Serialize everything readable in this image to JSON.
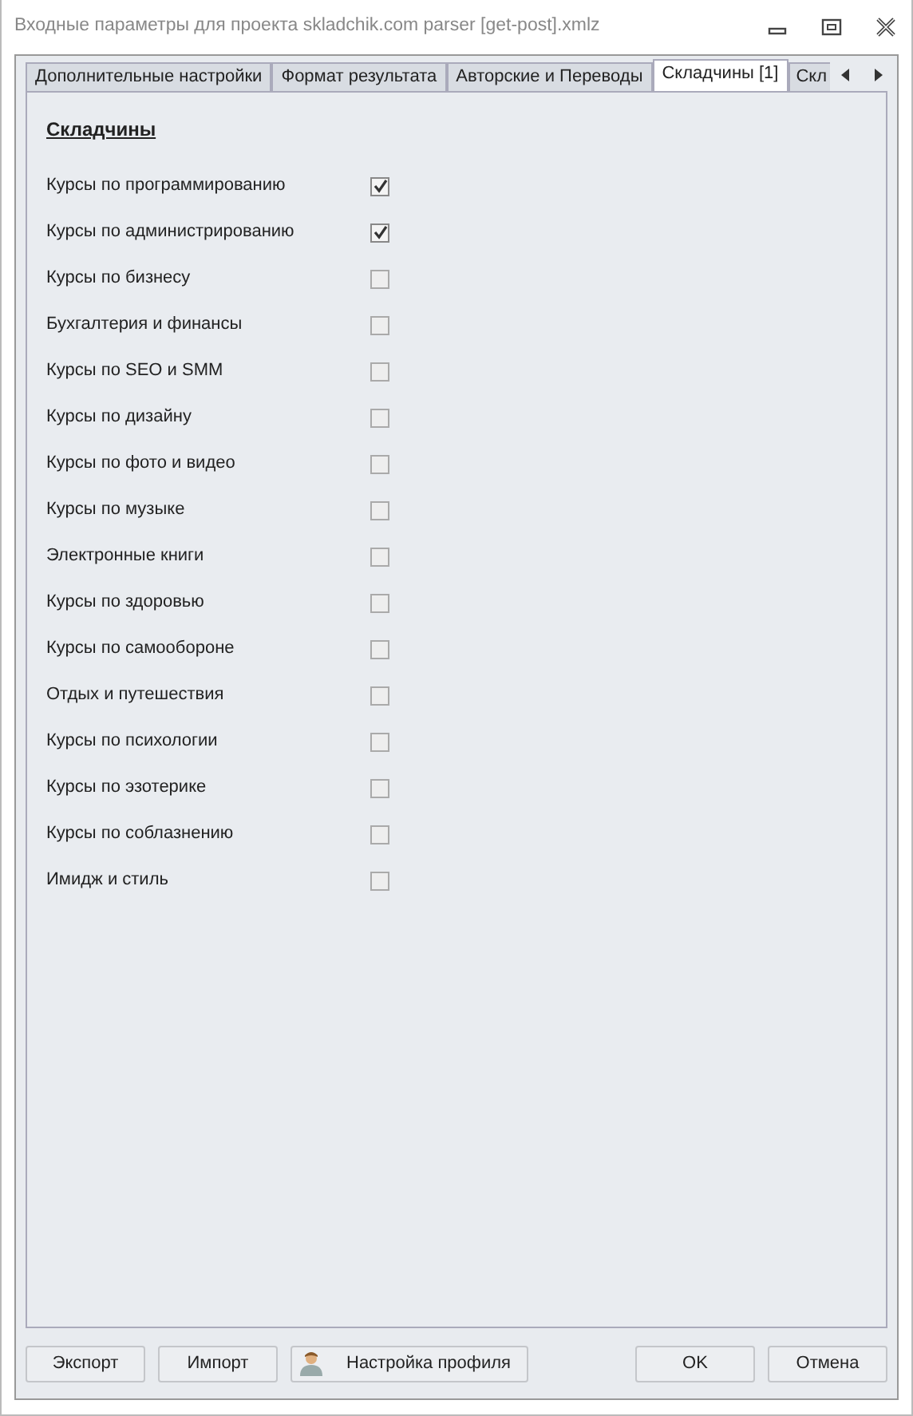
{
  "window": {
    "title": "Входные параметры для проекта skladchik.com parser [get-post].xmlz"
  },
  "tabs": [
    {
      "label": "Дополнительные настройки",
      "selected": false
    },
    {
      "label": "Формат результата",
      "selected": false
    },
    {
      "label": "Авторские и Переводы",
      "selected": false
    },
    {
      "label": "Складчины [1]",
      "selected": true
    },
    {
      "label": "Скл",
      "selected": false
    }
  ],
  "section": {
    "title": "Складчины"
  },
  "options": [
    {
      "label": "Курсы по программированию",
      "checked": true
    },
    {
      "label": "Курсы по администрированию",
      "checked": true
    },
    {
      "label": "Курсы по бизнесу",
      "checked": false
    },
    {
      "label": "Бухгалтерия и финансы",
      "checked": false
    },
    {
      "label": "Курсы по SEO и SMM",
      "checked": false
    },
    {
      "label": "Курсы по дизайну",
      "checked": false
    },
    {
      "label": "Курсы по фото и видео",
      "checked": false
    },
    {
      "label": "Курсы по музыке",
      "checked": false
    },
    {
      "label": "Электронные книги",
      "checked": false
    },
    {
      "label": "Курсы по здоровью",
      "checked": false
    },
    {
      "label": "Курсы по самообороне",
      "checked": false
    },
    {
      "label": "Отдых и путешествия",
      "checked": false
    },
    {
      "label": "Курсы по психологии",
      "checked": false
    },
    {
      "label": "Курсы по эзотерике",
      "checked": false
    },
    {
      "label": "Курсы по соблазнению",
      "checked": false
    },
    {
      "label": "Имидж и стиль",
      "checked": false
    }
  ],
  "buttons_left": [
    {
      "label": "Экспорт",
      "kind": "plain"
    },
    {
      "label": "Импорт",
      "kind": "plain"
    },
    {
      "label": "Настройка профиля",
      "kind": "profile"
    }
  ],
  "buttons_right": [
    {
      "label": "OK"
    },
    {
      "label": "Отмена"
    }
  ]
}
